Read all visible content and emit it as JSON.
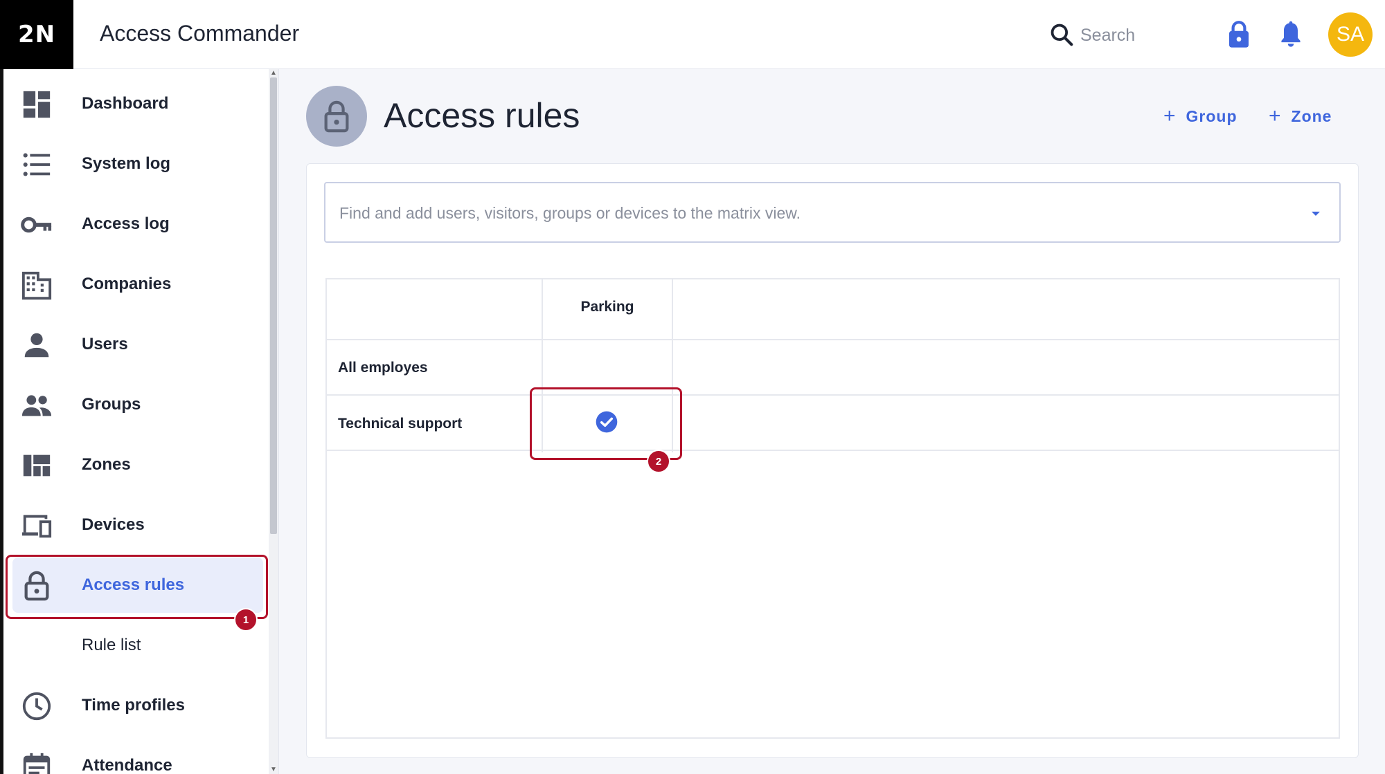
{
  "app": {
    "logo": "2N",
    "title": "Access Commander"
  },
  "header": {
    "search_placeholder": "Search",
    "avatar_initials": "SA"
  },
  "sidebar": {
    "items": [
      {
        "label": "Dashboard",
        "icon": "dashboard-icon"
      },
      {
        "label": "System log",
        "icon": "list-icon"
      },
      {
        "label": "Access log",
        "icon": "key-icon"
      },
      {
        "label": "Companies",
        "icon": "building-icon"
      },
      {
        "label": "Users",
        "icon": "user-icon"
      },
      {
        "label": "Groups",
        "icon": "group-icon"
      },
      {
        "label": "Zones",
        "icon": "zones-icon"
      },
      {
        "label": "Devices",
        "icon": "devices-icon"
      },
      {
        "label": "Access rules",
        "icon": "lock-open-icon",
        "active": true
      },
      {
        "label": "Rule list",
        "icon": ""
      },
      {
        "label": "Time profiles",
        "icon": "clock-icon"
      },
      {
        "label": "Attendance",
        "icon": "calendar-icon"
      }
    ]
  },
  "page": {
    "title": "Access rules",
    "add_group_label": "Group",
    "add_zone_label": "Zone",
    "matrix_search_placeholder": "Find and add users, visitors, groups or devices to the matrix view."
  },
  "matrix": {
    "columns": [
      "Parking"
    ],
    "rows": [
      {
        "label": "All employes",
        "cells": [
          false
        ]
      },
      {
        "label": "Technical support",
        "cells": [
          true
        ]
      }
    ]
  },
  "annotations": {
    "badge_1": "1",
    "badge_2": "2"
  },
  "colors": {
    "accent": "#3f66dd",
    "annotation": "#b3122b",
    "avatar": "#f4b70f",
    "logo_bg": "#000000"
  }
}
